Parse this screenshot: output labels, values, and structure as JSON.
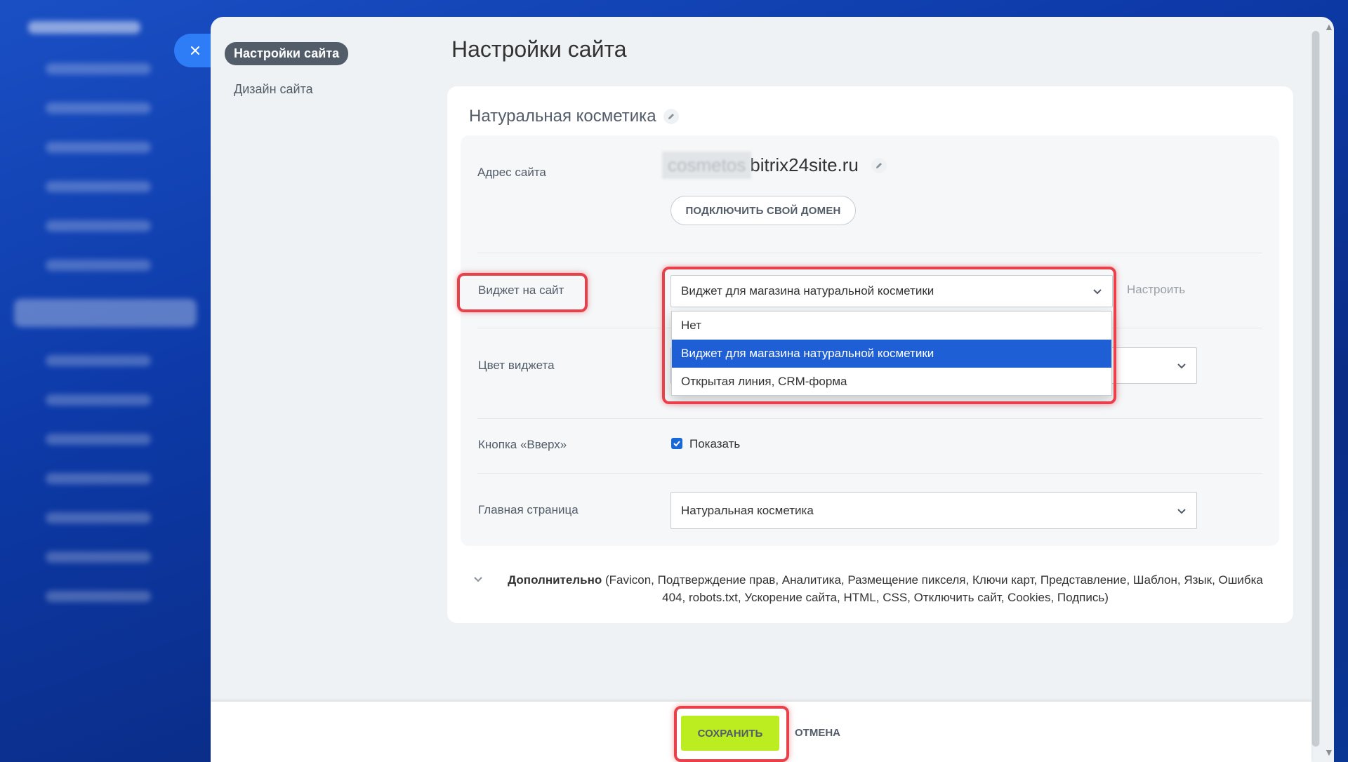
{
  "nav": {
    "close_icon": "close-icon",
    "items": [
      {
        "label": "Настройки сайта",
        "active": true
      },
      {
        "label": "Дизайн сайта",
        "active": false
      }
    ]
  },
  "page": {
    "title": "Настройки сайта",
    "site_name": "Натуральная косметика"
  },
  "fields": {
    "address": {
      "label": "Адрес сайта",
      "subdomain": "cosmetos",
      "domain": "bitrix24site.ru",
      "connect_button": "ПОДКЛЮЧИТЬ СВОЙ ДОМЕН"
    },
    "widget": {
      "label": "Виджет на сайт",
      "selected": "Виджет для магазина натуральной косметики",
      "setup_link": "Настроить",
      "options": [
        {
          "label": "Нет",
          "selected": false
        },
        {
          "label": "Виджет для магазина натуральной косметики",
          "selected": true
        },
        {
          "label": "Открытая линия, CRM-форма",
          "selected": false
        }
      ]
    },
    "widget_color": {
      "label": "Цвет виджета"
    },
    "up_button": {
      "label": "Кнопка «Вверх»",
      "checkbox_label": "Показать",
      "checked": true
    },
    "home_page": {
      "label": "Главная страница",
      "selected": "Натуральная косметика"
    }
  },
  "extra": {
    "title": "Дополнительно",
    "items": "(Favicon, Подтверждение прав, Аналитика, Размещение пикселя, Ключи карт, Представление, Шаблон, Язык, Ошибка 404, robots.txt, Ускорение сайта, HTML, CSS, Отключить сайт, Cookies, Подпись)"
  },
  "footer": {
    "save_label": "СОХРАНИТЬ",
    "cancel_label": "ОТМЕНА"
  },
  "colors": {
    "accent_blue": "#1e5fd6",
    "save_green": "#bbed21",
    "highlight_red": "#e8414b"
  }
}
